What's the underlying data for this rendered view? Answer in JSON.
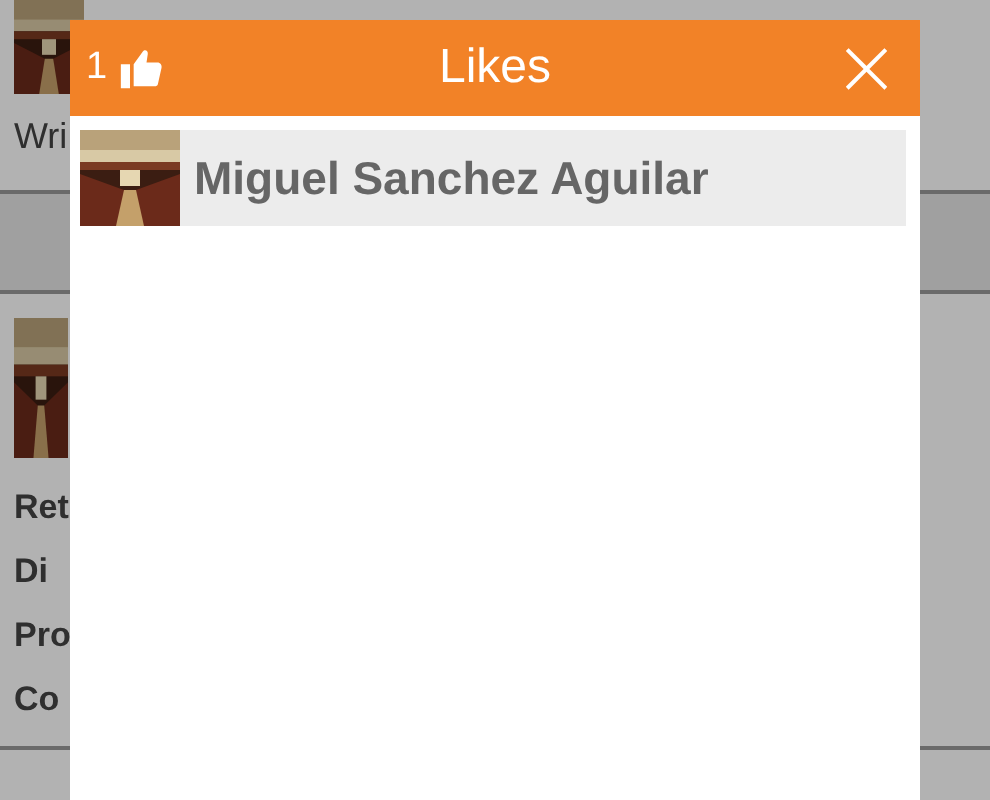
{
  "background": {
    "texts": [
      "Wri"
    ],
    "labels": [
      "Ret",
      "Di",
      "Pro",
      "Co"
    ]
  },
  "dialog": {
    "count": "1",
    "title": "Likes",
    "close": "×",
    "likes": [
      {
        "name": "Miguel Sanchez Aguilar"
      }
    ]
  }
}
